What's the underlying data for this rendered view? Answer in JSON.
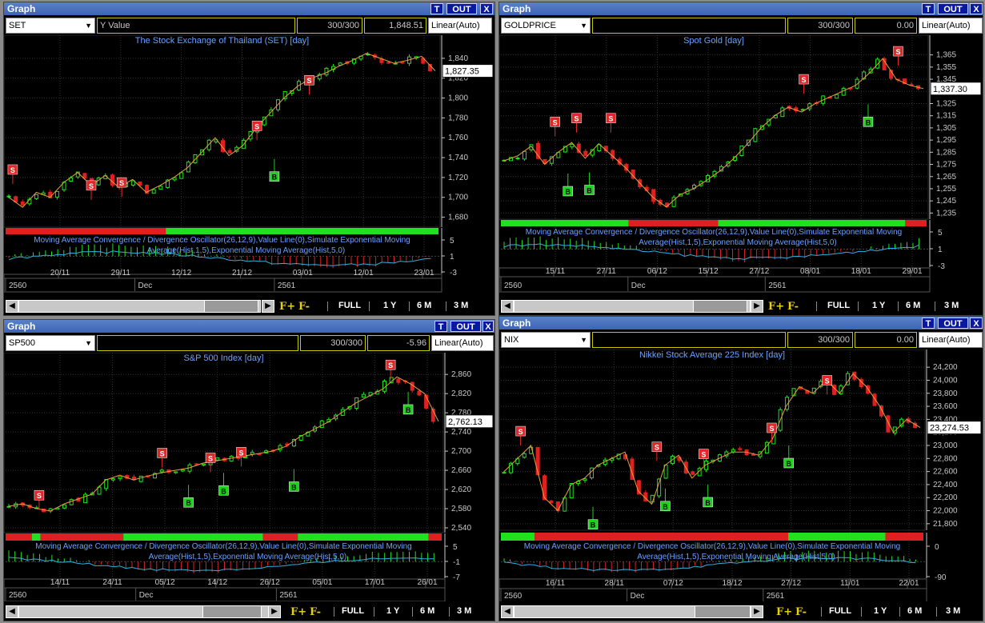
{
  "panels": [
    {
      "window_title": "Graph",
      "symbol": "SET",
      "field_label": "Y Value",
      "count": "300/300",
      "value": "1,848.51",
      "scale": "Linear(Auto)",
      "chart_title": "The Stock Exchange of Thailand (SET) [day]",
      "last_price": "1,827.35",
      "y_ticks": [
        "1,840",
        "1,820",
        "1,800",
        "1,780",
        "1,760",
        "1,740",
        "1,720",
        "1,700",
        "1,680"
      ],
      "ylim": [
        1670,
        1852
      ],
      "osc_label_1": "Moving Average Convergence / Divergence Oscillator(26,12,9),Value Line(0),Simulate Exponential Moving",
      "osc_label_2": "Average(Hist,1,5),Exponential Moving Average(Hist,5,0)",
      "osc_ticks": [
        "5",
        "1",
        "-3"
      ],
      "date_ticks": [
        "20/11",
        "29/11",
        "12/12",
        "21/12",
        "03/01",
        "12/01",
        "23/01"
      ],
      "year_labels": [
        "2560",
        "Dec",
        "2561"
      ],
      "nav": {
        "full": "FULL",
        "y1": "1 Y",
        "m6": "6 M",
        "m3": "3 M",
        "fplus": "F+",
        "fminus": "F-"
      },
      "buttons": {
        "t": "T",
        "out": "OUT",
        "x": "X"
      },
      "chart_data": {
        "type": "candlestick",
        "close_path": [
          1700,
          1690,
          1705,
          1700,
          1715,
          1725,
          1712,
          1722,
          1710,
          1718,
          1705,
          1712,
          1720,
          1730,
          1745,
          1760,
          1742,
          1752,
          1770,
          1785,
          1800,
          1812,
          1820,
          1825,
          1832,
          1838,
          1845,
          1840,
          1835,
          1838,
          1842,
          1827.35
        ]
      }
    },
    {
      "window_title": "Graph",
      "symbol": "GOLDPRICE",
      "field_label": "",
      "count": "300/300",
      "value": "0.00",
      "scale": "Linear(Auto)",
      "chart_title": "Spot Gold [day]",
      "last_price": "1,337.30",
      "y_ticks": [
        "1,365",
        "1,355",
        "1,345",
        "1,335",
        "1,325",
        "1,315",
        "1,305",
        "1,295",
        "1,285",
        "1,275",
        "1,265",
        "1,255",
        "1,245",
        "1,235"
      ],
      "ylim": [
        1230,
        1372
      ],
      "osc_label_1": "Moving Average Convergence / Divergence Oscillator(26,12,9),Value Line(0),Simulate Exponential Moving",
      "osc_label_2": "Average(Hist,1,5),Exponential Moving Average(Hist,5,0)",
      "osc_ticks": [
        "5",
        "1",
        "-3"
      ],
      "date_ticks": [
        "15/11",
        "27/11",
        "06/12",
        "15/12",
        "27/12",
        "08/01",
        "18/01",
        "29/01"
      ],
      "year_labels": [
        "2560",
        "Dec",
        "2561"
      ],
      "nav": {
        "full": "FULL",
        "y1": "1 Y",
        "m6": "6 M",
        "m3": "3 M",
        "fplus": "F+",
        "fminus": "F-"
      },
      "buttons": {
        "t": "T",
        "out": "OUT",
        "x": "X"
      },
      "chart_data": {
        "type": "candlestick",
        "close_path": [
          1278,
          1282,
          1290,
          1275,
          1285,
          1293,
          1280,
          1292,
          1282,
          1272,
          1260,
          1248,
          1240,
          1250,
          1255,
          1262,
          1270,
          1280,
          1292,
          1305,
          1315,
          1322,
          1318,
          1325,
          1330,
          1335,
          1340,
          1350,
          1362,
          1345,
          1340,
          1337.3
        ]
      }
    },
    {
      "window_title": "Graph",
      "symbol": "SP500",
      "field_label": "",
      "count": "300/300",
      "value": "-5.96",
      "scale": "Linear(Auto)",
      "chart_title": "S&P 500 Index [day]",
      "last_price": "2,762.13",
      "y_ticks": [
        "2,860",
        "2,820",
        "2,780",
        "2,740",
        "2,700",
        "2,660",
        "2,620",
        "2,580",
        "2,540"
      ],
      "ylim": [
        2530,
        2882
      ],
      "osc_label_1": "Moving Average Convergence / Divergence Oscillator(26,12,9),Value Line(0),Simulate Exponential Moving",
      "osc_label_2": "Average(Hist,1,5),Exponential Moving Average(Hist,5,0)",
      "osc_ticks": [
        "5",
        "-1",
        "-7"
      ],
      "date_ticks": [
        "14/11",
        "24/11",
        "05/12",
        "14/12",
        "26/12",
        "05/01",
        "17/01",
        "26/01"
      ],
      "year_labels": [
        "2560",
        "Dec",
        "2561"
      ],
      "nav": {
        "full": "FULL",
        "y1": "1 Y",
        "m6": "6 M",
        "m3": "3 M",
        "fplus": "F+",
        "fminus": "F-"
      },
      "buttons": {
        "t": "T",
        "out": "OUT",
        "x": "X"
      },
      "chart_data": {
        "type": "candlestick",
        "close_path": [
          2585,
          2590,
          2580,
          2575,
          2590,
          2600,
          2610,
          2640,
          2650,
          2640,
          2648,
          2655,
          2660,
          2665,
          2675,
          2680,
          2685,
          2690,
          2695,
          2700,
          2710,
          2730,
          2745,
          2760,
          2780,
          2800,
          2815,
          2830,
          2855,
          2840,
          2820,
          2762.13
        ]
      }
    },
    {
      "window_title": "Graph",
      "symbol": "NIX",
      "field_label": "",
      "count": "300/300",
      "value": "0.00",
      "scale": "Linear(Auto)",
      "chart_title": "Nikkei Stock Average 225 Index [day]",
      "last_price": "23,274.53",
      "y_ticks": [
        "24,200",
        "24,000",
        "23,800",
        "23,600",
        "23,400",
        "23,200",
        "23,000",
        "22,800",
        "22,600",
        "22,400",
        "22,200",
        "22,000",
        "21,800"
      ],
      "ylim": [
        21700,
        24300
      ],
      "osc_label_1": "Moving Average Convergence / Divergence Oscillator(26,12,9),Value Line(0),Simulate Exponential Moving",
      "osc_label_2": "Average(Hist,1,5),Exponential Moving Average(Hist,5,0)",
      "osc_ticks": [
        "0",
        "-90"
      ],
      "date_ticks": [
        "16/11",
        "28/11",
        "07/12",
        "18/12",
        "27/12",
        "11/01",
        "22/01"
      ],
      "year_labels": [
        "2560",
        "Dec",
        "2561"
      ],
      "nav": {
        "full": "FULL",
        "y1": "1 Y",
        "m6": "6 M",
        "m3": "3 M",
        "fplus": "F+",
        "fminus": "F-"
      },
      "buttons": {
        "t": "T",
        "out": "OUT",
        "x": "X"
      },
      "chart_data": {
        "type": "candlestick",
        "close_path": [
          22600,
          22800,
          23000,
          22200,
          22000,
          22400,
          22500,
          22700,
          22800,
          22900,
          22300,
          22100,
          22700,
          22850,
          22500,
          22700,
          22800,
          22900,
          22900,
          22850,
          23100,
          23600,
          23900,
          23800,
          24000,
          23800,
          24100,
          23900,
          23600,
          23200,
          23400,
          23274.53
        ]
      }
    }
  ],
  "colors": {
    "up": "#20e020",
    "down": "#e02020",
    "grid": "#333333",
    "axis": "#c8c8c8",
    "title": "#6aa0ff",
    "zigzag": "#e6a040",
    "signal_s": "#e02828",
    "signal_b": "#20d020",
    "ema": "#30b0e0"
  }
}
